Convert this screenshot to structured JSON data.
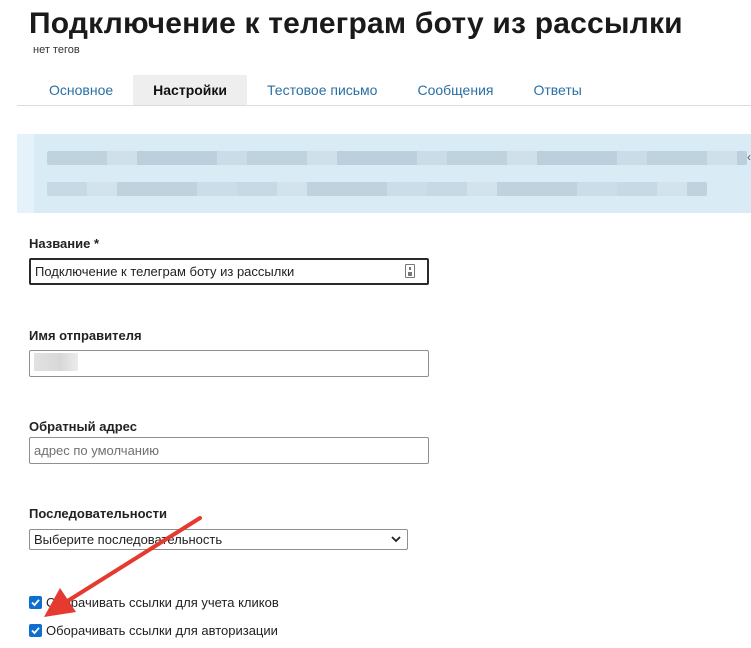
{
  "header": {
    "title": "Подключение к телеграм боту из рассылки",
    "tags_text": "нет тегов"
  },
  "tabs": [
    {
      "label": "Основное",
      "active": false
    },
    {
      "label": "Настройки",
      "active": true
    },
    {
      "label": "Тестовое письмо",
      "active": false
    },
    {
      "label": "Сообщения",
      "active": false
    },
    {
      "label": "Ответы",
      "active": false
    }
  ],
  "form": {
    "name": {
      "label": "Название *",
      "value": "Подключение к телеграм боту из рассылки"
    },
    "sender_name": {
      "label": "Имя отправителя",
      "value": ""
    },
    "reply_address": {
      "label": "Обратный адрес",
      "value": "",
      "placeholder": "адрес по умолчанию"
    },
    "sequences": {
      "label": "Последовательности",
      "selected": "Выберите последовательность"
    },
    "wrap_links_clicks": {
      "label": "Оборачивать ссылки для учета кликов",
      "checked": true
    },
    "wrap_links_auth": {
      "label": "Оборачивать ссылки для авторизации",
      "checked": true
    }
  },
  "colors": {
    "tab_link": "#2b6fa3",
    "banner_background": "#d9ecf6",
    "checkbox_accent": "#0f6fcf",
    "annotation_arrow": "#e53a2f"
  },
  "icons": {
    "autofill": "autofill-contact-icon",
    "select_caret": "chevron-down-icon",
    "checkmark": "checkmark-icon",
    "annotation": "red-arrow-annotation"
  }
}
